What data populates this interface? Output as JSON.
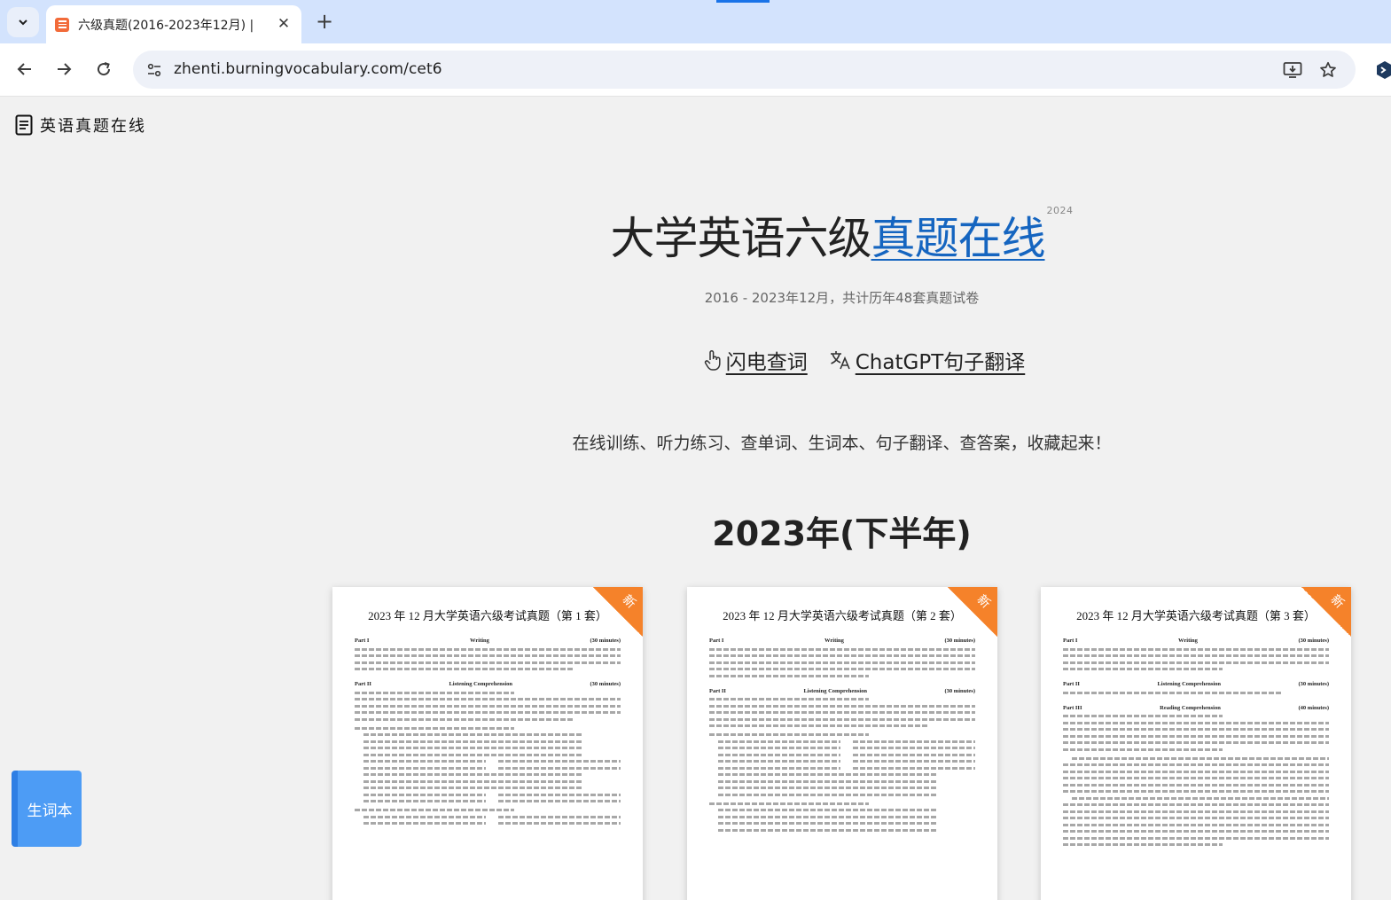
{
  "browser": {
    "tab": {
      "title": "六级真题(2016-2023年12月) |"
    },
    "address_bar": {
      "url": "zhenti.burningvocabulary.com/cet6"
    }
  },
  "brand": {
    "name": "英语真题在线"
  },
  "hero": {
    "title_plain": "大学英语六级",
    "title_accent": "真题在线",
    "title_sup": "2024",
    "subtitle": "2016 - 2023年12月，共计历年48套真题试卷"
  },
  "features": {
    "lookup": {
      "label": "闪电查词",
      "icon": "hand-pointer-icon"
    },
    "translate": {
      "label": "ChatGPT句子翻译",
      "icon": "translate-icon"
    }
  },
  "tagline": "在线训练、听力练习、查单词、生词本、句子翻译、查答案，收藏起来！",
  "section": {
    "year_heading": "2023年(下半年)"
  },
  "papers": [
    {
      "title": "2023 年 12 月大学英语六级考试真题（第 1 套）",
      "badge": "新",
      "part1": {
        "name": "Part I",
        "section": "Writing",
        "time": "(30 minutes)"
      },
      "part2": {
        "name": "Part II",
        "section": "Listening Comprehension",
        "time": "(30 minutes)"
      }
    },
    {
      "title": "2023 年 12 月大学英语六级考试真题（第 2 套）",
      "badge": "新",
      "part1": {
        "name": "Part I",
        "section": "Writing",
        "time": "(30 minutes)"
      },
      "part2": {
        "name": "Part II",
        "section": "Listening Comprehension",
        "time": "(30 minutes)"
      }
    },
    {
      "title": "2023 年 12 月大学英语六级考试真题（第 3 套）",
      "badge": "新",
      "part1": {
        "name": "Part I",
        "section": "Writing",
        "time": "(30 minutes)"
      },
      "part2": {
        "name": "Part II",
        "section": "Listening Comprehension",
        "time": "(30 minutes)"
      },
      "part3": {
        "name": "Part III",
        "section": "Reading Comprehension",
        "time": "(40 minutes)"
      }
    }
  ],
  "vocab_button": {
    "label": "生词本"
  },
  "colors": {
    "accent": "#1565c0",
    "ribbon": "#f5822a",
    "vocab_button": "#4d9cf5",
    "tabstrip": "#d3e3fd"
  }
}
